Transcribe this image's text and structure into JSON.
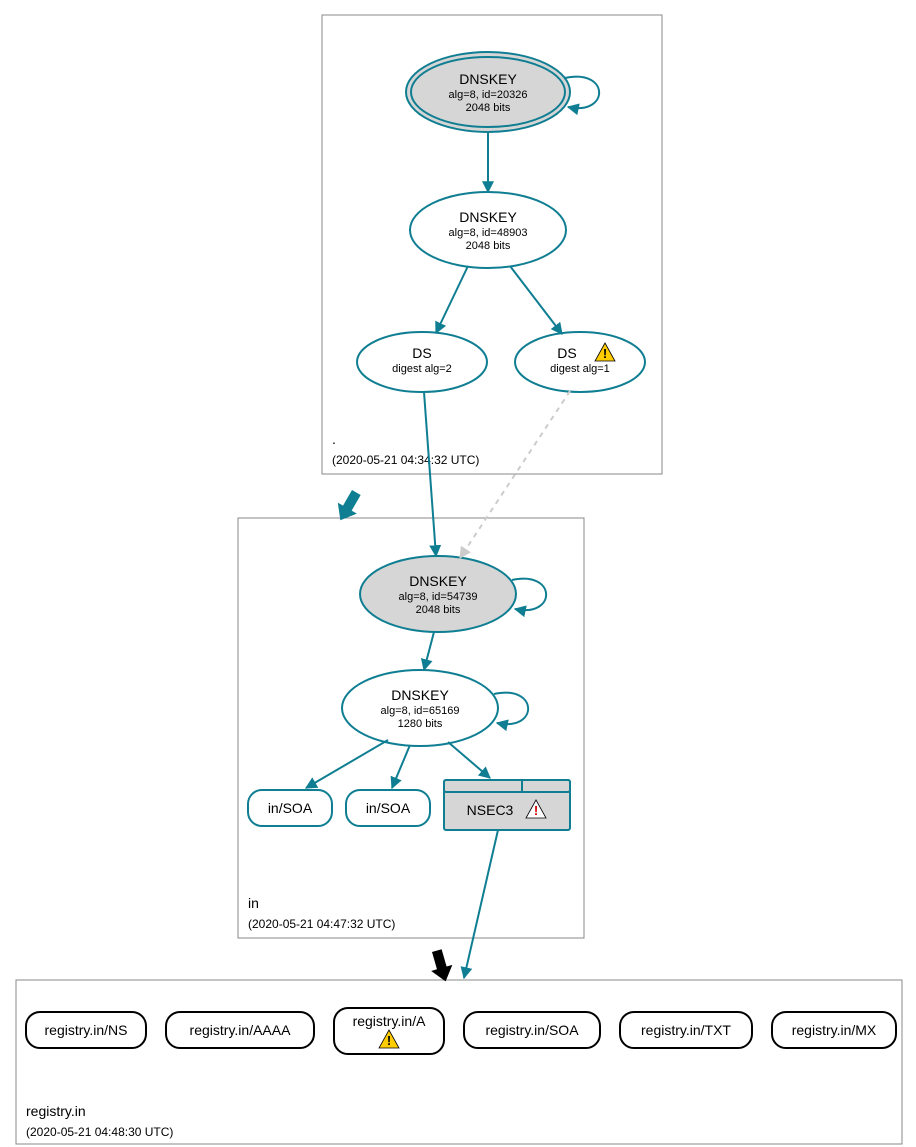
{
  "zones": {
    "root": {
      "name": ".",
      "timestamp": "(2020-05-21 04:34:32 UTC)"
    },
    "in": {
      "name": "in",
      "timestamp": "(2020-05-21 04:47:32 UTC)"
    },
    "registry": {
      "name": "registry.in",
      "timestamp": "(2020-05-21 04:48:30 UTC)"
    }
  },
  "nodes": {
    "root_ksk": {
      "title": "DNSKEY",
      "sub1": "alg=8, id=20326",
      "sub2": "2048 bits"
    },
    "root_zsk": {
      "title": "DNSKEY",
      "sub1": "alg=8, id=48903",
      "sub2": "2048 bits"
    },
    "ds2": {
      "title": "DS",
      "sub1": "digest alg=2"
    },
    "ds1": {
      "title": "DS",
      "sub1": "digest alg=1"
    },
    "in_ksk": {
      "title": "DNSKEY",
      "sub1": "alg=8, id=54739",
      "sub2": "2048 bits"
    },
    "in_zsk": {
      "title": "DNSKEY",
      "sub1": "alg=8, id=65169",
      "sub2": "1280 bits"
    },
    "soa1": {
      "title": "in/SOA"
    },
    "soa2": {
      "title": "in/SOA"
    },
    "nsec3": {
      "title": "NSEC3"
    },
    "leaf_ns": {
      "title": "registry.in/NS"
    },
    "leaf_aaaa": {
      "title": "registry.in/AAAA"
    },
    "leaf_a": {
      "title": "registry.in/A"
    },
    "leaf_soa": {
      "title": "registry.in/SOA"
    },
    "leaf_txt": {
      "title": "registry.in/TXT"
    },
    "leaf_mx": {
      "title": "registry.in/MX"
    }
  }
}
